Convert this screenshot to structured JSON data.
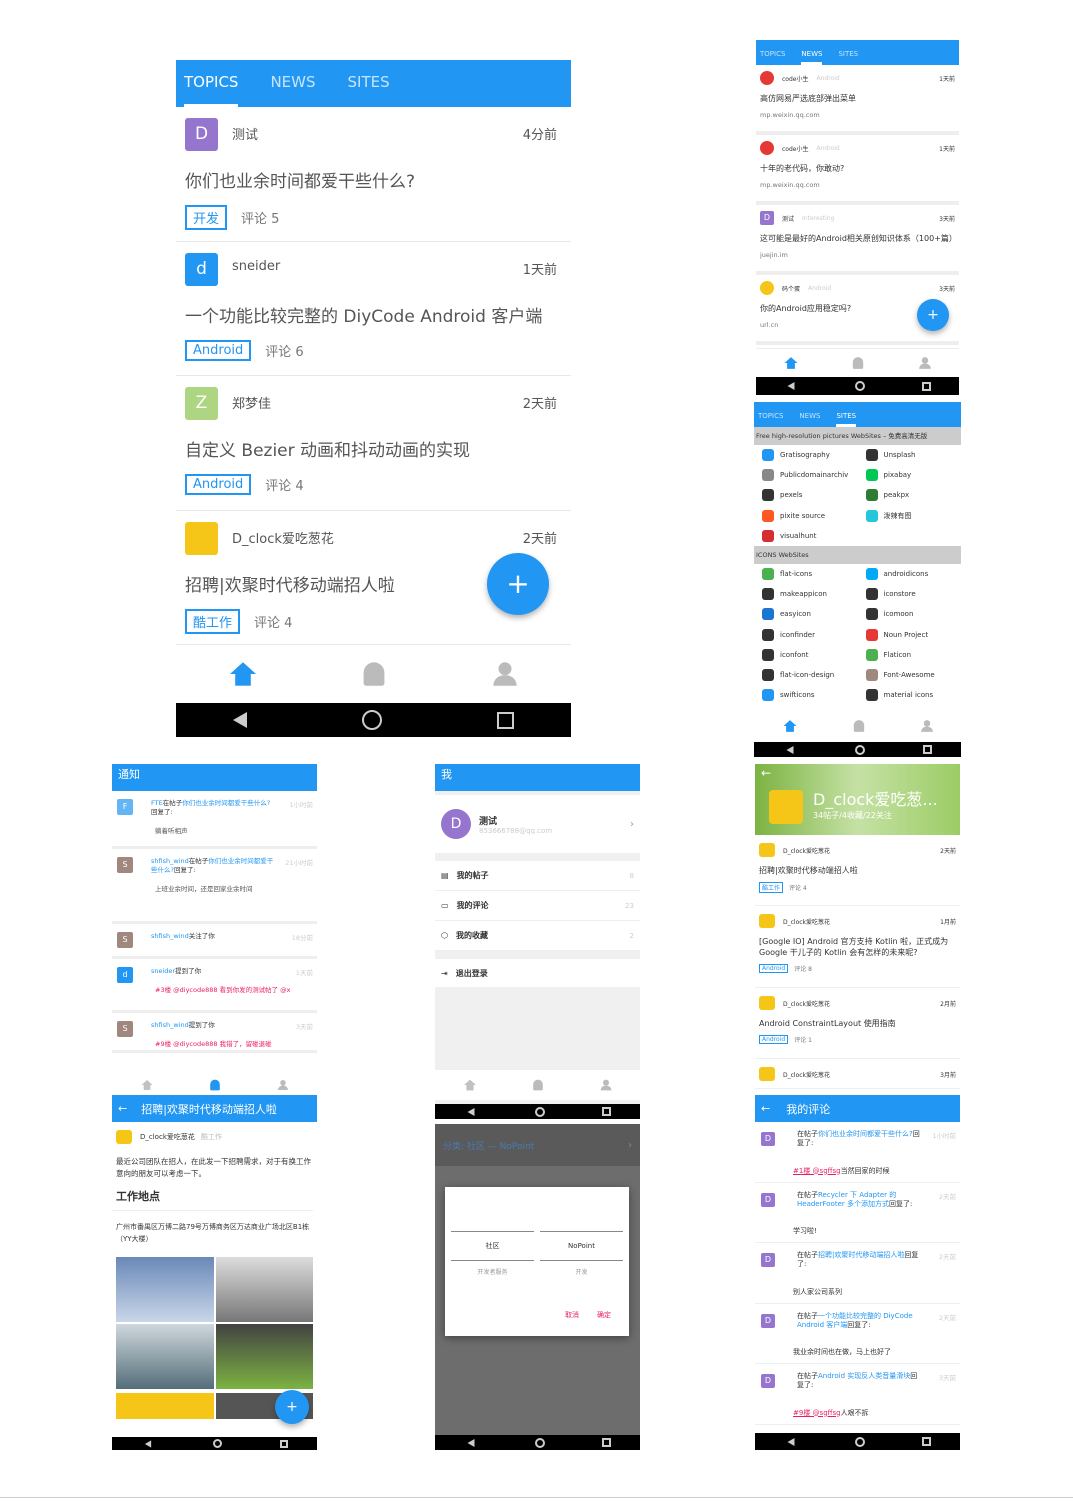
{
  "colors": {
    "primary": "#2196F3",
    "accent": "#e91e63"
  },
  "tabs": [
    "TOPICS",
    "NEWS",
    "SITES"
  ],
  "p1": {
    "topics": [
      {
        "avatar": "D",
        "avatar_color": "#9575CD",
        "user": "测试",
        "time": "4分前",
        "title": "你们也业余时间都爱干些什么?",
        "tag": "开发",
        "comments": "评论 5"
      },
      {
        "avatar": "d",
        "avatar_color": "#2196F3",
        "user": "sneider",
        "time": "1天前",
        "title": "一个功能比较完整的 DiyCode Android 客户端",
        "tag": "Android",
        "comments": "评论 6"
      },
      {
        "avatar": "Z",
        "avatar_color": "#AED581",
        "user": "郑梦佳",
        "time": "2天前",
        "title": "自定义 Bezier 动画和抖动动画的实现",
        "tag": "Android",
        "comments": "评论 4"
      },
      {
        "avatar": "",
        "avatar_color": "#F5C518",
        "user": "D_clock爱吃葱花",
        "time": "2天前",
        "title": "招聘|欢聚时代移动端招人啦",
        "tag": "酷工作",
        "comments": "评论 4"
      }
    ],
    "fab": "+"
  },
  "p2": {
    "news": [
      {
        "avatar_color": "#e53935",
        "user": "code小生",
        "node": "Android",
        "time": "1天前",
        "title": "高仿网易严选底部弹出菜单",
        "host": "mp.weixin.qq.com"
      },
      {
        "avatar_color": "#e53935",
        "user": "code小生",
        "node": "Android",
        "time": "1天前",
        "title": "十年的老代码，你敢动?",
        "host": "mp.weixin.qq.com"
      },
      {
        "avatar_color": "#9575CD",
        "avatar": "D",
        "user": "测试",
        "node": "Interesting",
        "time": "3天前",
        "title": "这可能是最好的Android相关原创知识体系（100+篇）",
        "host": "juejin.im"
      },
      {
        "avatar_color": "#F5C518",
        "user": "码个蛋",
        "node": "Android",
        "time": "3天前",
        "title": "你的Android应用稳定吗?",
        "host": "url.cn"
      }
    ]
  },
  "p3": {
    "section1": "Free high-resolution pictures WebSites – 免费高清无版",
    "sites1": [
      "Gratisography",
      "Unsplash",
      "Publicdomainarchiv",
      "pixabay",
      "pexels",
      "peakpx",
      "pixite source",
      "泼辣有图",
      "visualhunt"
    ],
    "section2": "ICONS WebSites",
    "sites2": [
      "flat-icons",
      "androidicons",
      "makeappicon",
      "iconstore",
      "easyicon",
      "icomoon",
      "iconfinder",
      "Noun Project",
      "iconfont",
      "Flaticon",
      "flat-icon-design",
      "Font-Awesome",
      "swifticons",
      "material icons"
    ]
  },
  "p4": {
    "title": "通知",
    "items": [
      {
        "avatar": "F",
        "avatar_color": "#64B5F6",
        "user": "FTE",
        "pre": "在帖子",
        "link": "你们也业余时间都爱干些什么?",
        "post": "回复了:",
        "time": "1小时前",
        "body": "躺着听相声"
      },
      {
        "avatar": "S",
        "avatar_color": "#A1887F",
        "user": "shfish_wind",
        "pre": "在帖子",
        "link": "你们也业余时间都爱干些什么?",
        "post": "回复了:",
        "time": "21小时前",
        "body": "上班业余时间，还是回家业余时间"
      },
      {
        "avatar": "S",
        "avatar_color": "#A1887F",
        "user": "shfish_wind",
        "pre": "关注了你",
        "link": "",
        "post": "",
        "time": "18分前",
        "body": ""
      },
      {
        "avatar": "d",
        "avatar_color": "#2196F3",
        "user": "sneider",
        "pre": "提到了你",
        "link": "",
        "post": "",
        "time": "1天前",
        "body": "#3楼 @diycode888 看到你发的测试帖了 @x"
      },
      {
        "avatar": "S",
        "avatar_color": "#A1887F",
        "user": "shfish_wind",
        "pre": "提到了你",
        "link": "",
        "post": "",
        "time": "3天前",
        "body": "#9楼 @diycode888 我错了，留碰退碰"
      }
    ]
  },
  "p5": {
    "title": "我",
    "name": "测试",
    "email": "853666788@qq.com",
    "avatar": "D",
    "menu": [
      {
        "label": "我的帖子",
        "count": "8"
      },
      {
        "label": "我的评论",
        "count": "23"
      },
      {
        "label": "我的收藏",
        "count": "2"
      }
    ],
    "logout": "退出登录"
  },
  "p6": {
    "name": "D_clock爱吃葱...",
    "stats": "34帖子/4收藏/22关注",
    "items": [
      {
        "user": "D_clock爱吃葱花",
        "time": "2天前",
        "title": "招聘|欢聚时代移动端招人啦",
        "tag": "酷工作",
        "comments": "评论 4"
      },
      {
        "user": "D_clock爱吃葱花",
        "time": "1月前",
        "title": "[Google IO] Android 官方支持 Kotlin 啦，正式成为 Google 干儿子的 Kotlin 会有怎样的未来呢?",
        "tag": "Android",
        "comments": "评论 8"
      },
      {
        "user": "D_clock爱吃葱花",
        "time": "2月前",
        "title": "Android ConstraintLayout 使用指南",
        "tag": "Android",
        "comments": "评论 1"
      },
      {
        "user": "D_clock爱吃葱花",
        "time": "3月前",
        "title": "",
        "tag": "",
        "comments": ""
      }
    ]
  },
  "p7": {
    "title": "招聘|欢聚时代移动端招人啦",
    "user": "D_clock爱吃葱花",
    "node": "酷工作",
    "intro": "最近公司团队在招人，在此发一下招聘需求，对于有换工作意向的朋友可以考虑一下。",
    "h2": "工作地点",
    "address": "广州市番禺区万博二路79号万博商务区万达商业广场北区B1栋（YY大楼）"
  },
  "p8": {
    "category": "分类: 社区 — NoPoint",
    "col1": "社区",
    "col2": "NoPoint",
    "sub1": "开发者服务",
    "sub2": "开发",
    "cancel": "取消",
    "ok": "确定"
  },
  "p9": {
    "title": "我的评论",
    "items": [
      {
        "pre": "在帖子",
        "link": "你们也业余时间都爱干些什么?",
        "post": "回复了:",
        "time": "1小时前",
        "body": "",
        "body_pink": "#1楼 @sgffsg",
        "body_rest": "当然回家的时候"
      },
      {
        "pre": "在帖子",
        "link": "Recycler 下 Adapter 的 HeaderFooter 多个添加方式",
        "post": "回复了:",
        "time": "2天前",
        "body": "学习啦!",
        "body_pink": "",
        "body_rest": ""
      },
      {
        "pre": "在帖子",
        "link": "招聘|欢聚时代移动端招人啦",
        "post": "回复了:",
        "time": "2天前",
        "body": "别人家公司系列",
        "body_pink": "",
        "body_rest": ""
      },
      {
        "pre": "在帖子",
        "link": "一个功能比较完整的 DiyCode Android 客户端",
        "post": "回复了:",
        "time": "2天前",
        "body": "我业余时间也在做，马上也好了",
        "body_pink": "",
        "body_rest": ""
      },
      {
        "pre": "在帖子",
        "link": "Android 实现反人类音量滑块",
        "post": "回复了:",
        "time": "3天前",
        "body": "",
        "body_pink": "#9楼 @sgffsg",
        "body_rest": "人艰不拆"
      }
    ]
  }
}
